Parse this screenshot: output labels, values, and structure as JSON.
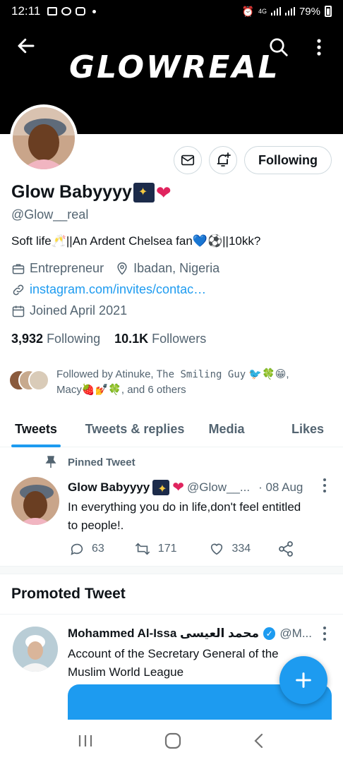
{
  "status": {
    "time": "12:11",
    "battery": "79%",
    "net": "4G"
  },
  "banner": {
    "brand": "GLOWREAL"
  },
  "actions": {
    "follow_label": "Following"
  },
  "profile": {
    "name": "Glow Babyyyy",
    "handle": "@Glow__real",
    "bio": "Soft life🥂||An Ardent Chelsea fan💙⚽||10kk?",
    "occupation": "Entrepreneur",
    "location": "Ibadan, Nigeria",
    "link": "instagram.com/invites/contac…",
    "joined": "Joined April 2021",
    "following_count": "3,932",
    "following_label": "Following",
    "followers_count": "10.1K",
    "followers_label": "Followers",
    "followed_by_prefix": "Followed by Atinuke, ",
    "followed_by_mono": "The Smiling Guy",
    "followed_by_rest": " 🐦🍀😁, Macy🍓💅🍀, and 6 others"
  },
  "tabs": [
    "Tweets",
    "Tweets & replies",
    "Media",
    "Likes"
  ],
  "pinned_tweet": {
    "label": "Pinned Tweet",
    "name": "Glow Babyyyy",
    "handle": "@Glow__...",
    "date": "· 08 Aug",
    "text": "In everything you do in life,don't feel entitled to people!.",
    "replies": "63",
    "retweets": "171",
    "likes": "334"
  },
  "promoted": {
    "section_title": "Promoted Tweet",
    "name": "Mohammed Al-Issa محمد العيسى",
    "handle": "@M...",
    "text": "Account of the Secretary General of the Muslim World League"
  },
  "colors": {
    "accent": "#1d9bf0",
    "heart": "#e0245e",
    "muted": "#536471"
  }
}
